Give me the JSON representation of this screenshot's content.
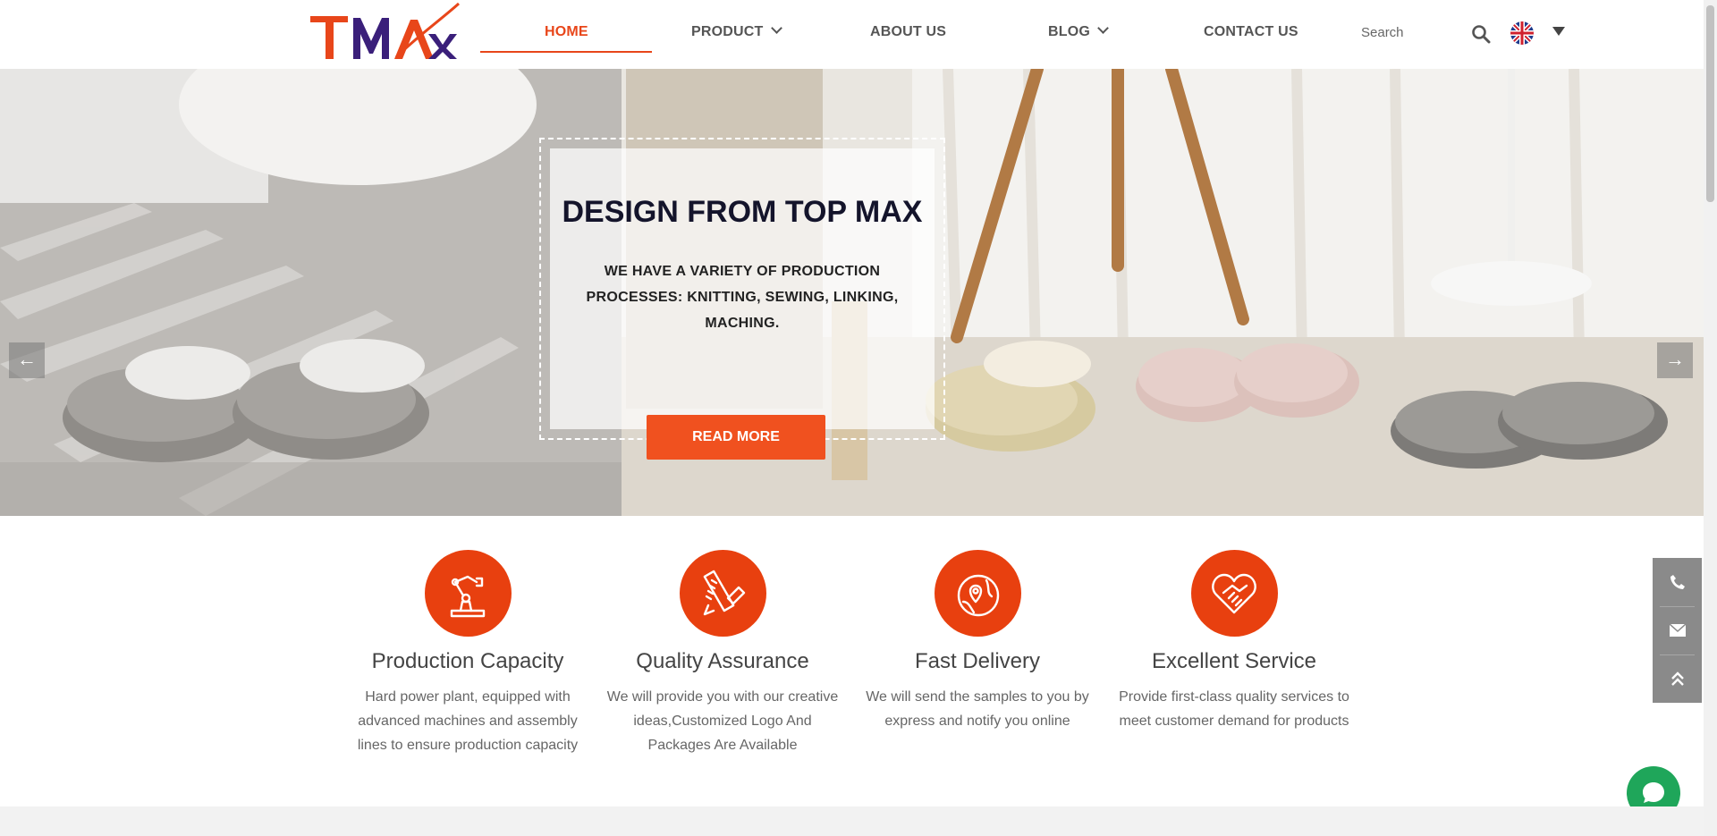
{
  "header": {
    "logo_text": "TMAX",
    "nav": {
      "home": "HOME",
      "product": "PRODUCT",
      "about": "ABOUT US",
      "blog": "BLOG",
      "contact": "CONTACT US"
    },
    "search_placeholder": "Search",
    "language_icon": "uk-flag-icon"
  },
  "hero": {
    "title": "DESIGN FROM TOP MAX",
    "subtitle": "WE HAVE A VARIETY OF PRODUCTION PROCESSES: KNITTING, SEWING, LINKING, MACHING.",
    "button": "READ MORE",
    "prev_arrow": "←",
    "next_arrow": "→",
    "slide_count": 3,
    "active_slide": 1
  },
  "features": [
    {
      "icon": "robot-arm-icon",
      "title": "Production Capacity",
      "desc": "Hard power plant, equipped with advanced machines and assembly lines to ensure production capacity"
    },
    {
      "icon": "ruler-pencil-icon",
      "title": "Quality Assurance",
      "desc": "We will provide you with our creative ideas,Customized Logo And Packages Are Available"
    },
    {
      "icon": "globe-pin-icon",
      "title": "Fast Delivery",
      "desc": "We will send the samples to you by express and notify you online"
    },
    {
      "icon": "heart-hand-icon",
      "title": "Excellent Service",
      "desc": "Provide first-class quality services to meet customer demand for products"
    }
  ],
  "colors": {
    "accent": "#e8461a",
    "button": "#f0511f",
    "chat": "#1fa65a",
    "side_bar": "#8a8a8a"
  }
}
